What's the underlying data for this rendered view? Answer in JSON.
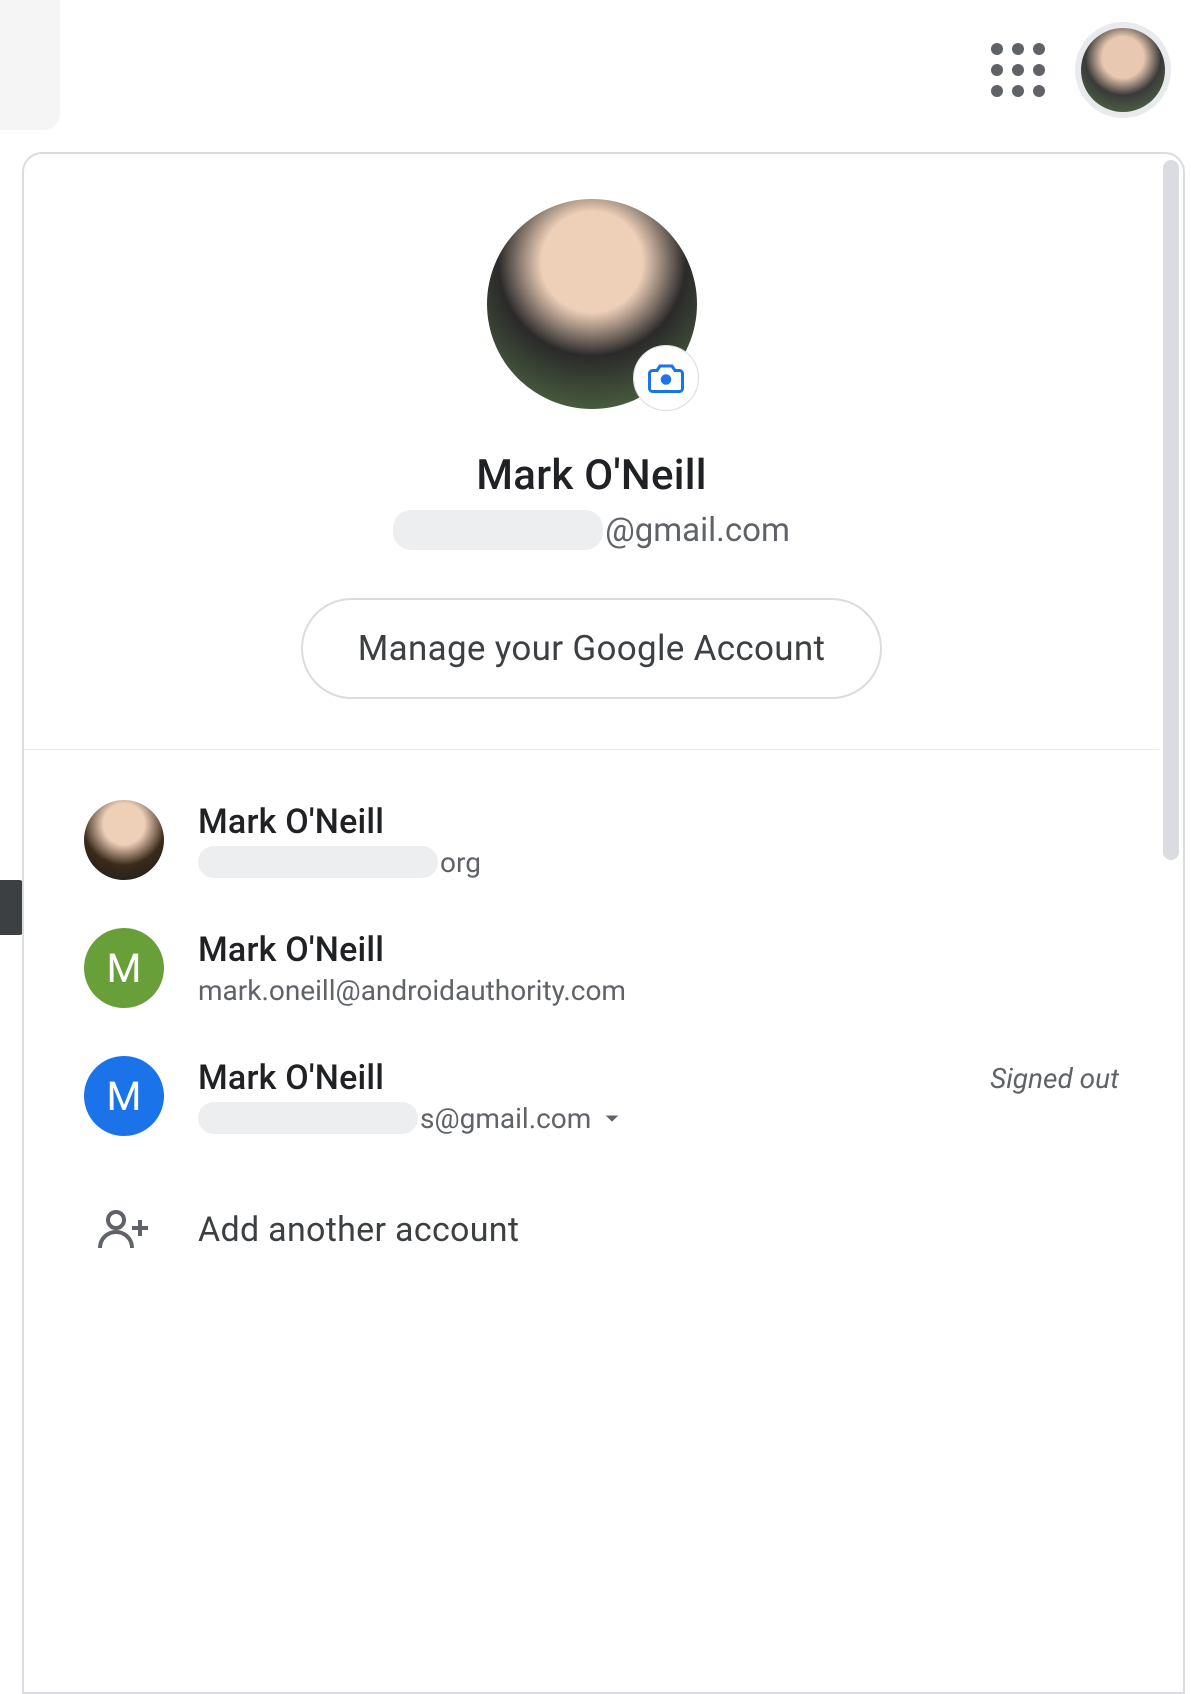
{
  "current_user": {
    "name": "Mark O'Neill",
    "email_visible_suffix": "@gmail.com"
  },
  "manage_button_label": "Manage your Google Account",
  "accounts": [
    {
      "name": "Mark O'Neill",
      "email_visible_suffix": "org",
      "avatar_type": "photo",
      "initial": "",
      "status": ""
    },
    {
      "name": "Mark O'Neill",
      "email": "mark.oneill@androidauthority.com",
      "avatar_type": "green",
      "initial": "M",
      "status": ""
    },
    {
      "name": "Mark O'Neill",
      "email_visible_suffix": "s@gmail.com",
      "avatar_type": "blue",
      "initial": "M",
      "status": "Signed out"
    }
  ],
  "add_account_label": "Add another account"
}
